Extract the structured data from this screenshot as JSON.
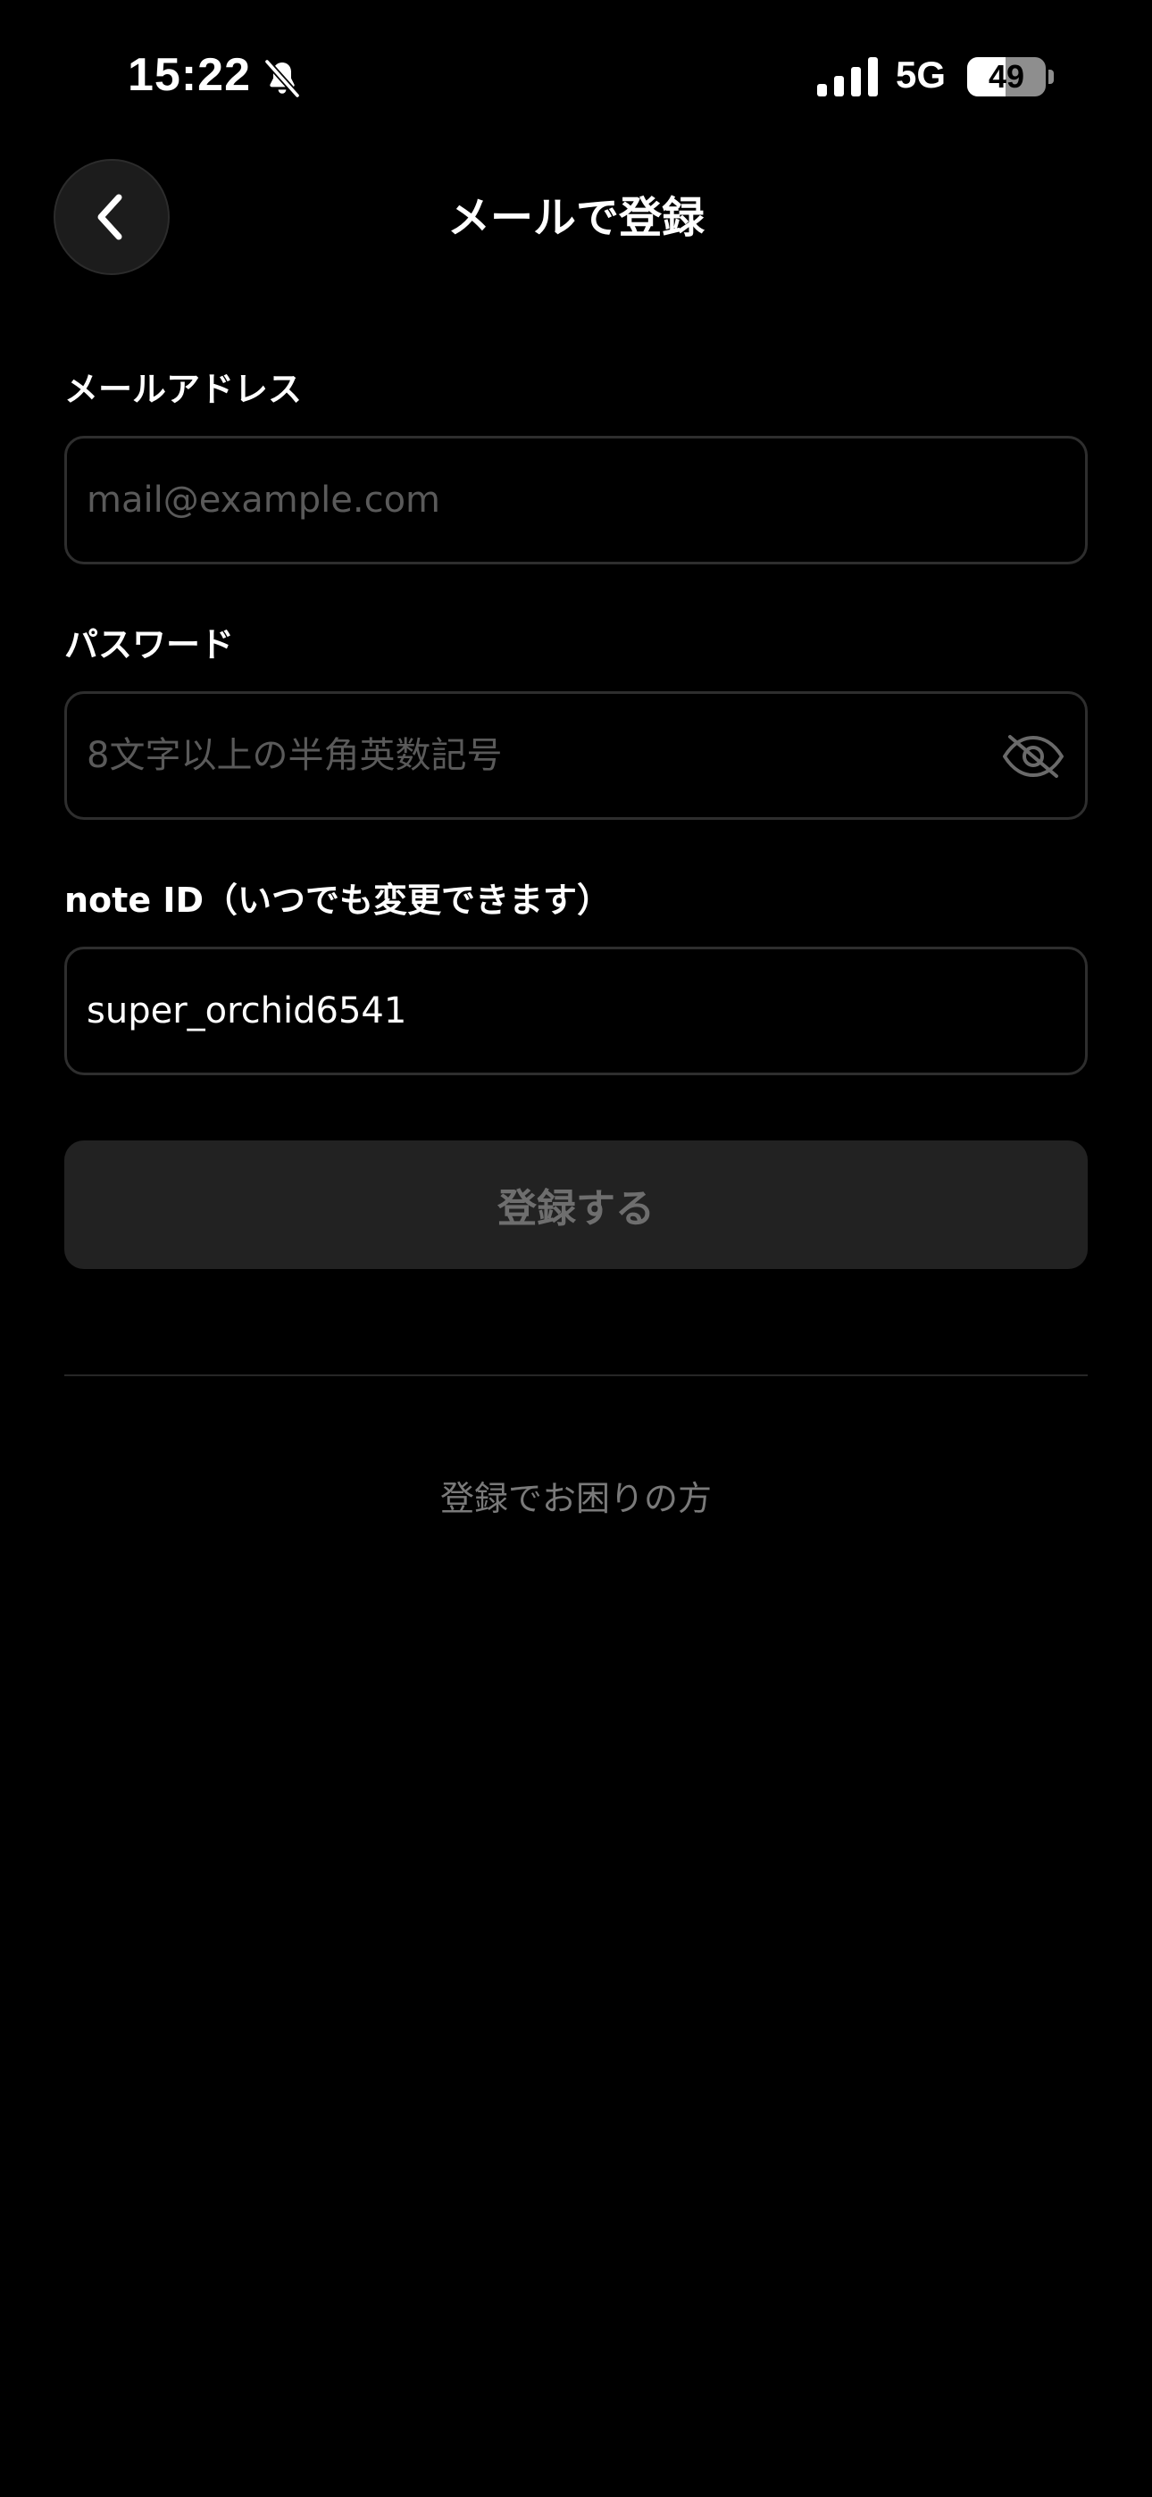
{
  "status_bar": {
    "time": "15:22",
    "network": "5G",
    "battery_percent": 49,
    "battery_text": "49"
  },
  "header": {
    "title": "メールで登録"
  },
  "form": {
    "email": {
      "label": "メールアドレス",
      "placeholder": "mail@example.com",
      "value": ""
    },
    "password": {
      "label": "パスワード",
      "placeholder": "8文字以上の半角英数記号",
      "value": ""
    },
    "note_id": {
      "label": "note ID（いつでも変更できます）",
      "value": "super_orchid6541"
    },
    "submit_label": "登録する"
  },
  "help": {
    "label": "登録でお困りの方"
  },
  "colors": {
    "background": "#000000",
    "field_border": "#2e2e2e",
    "button_disabled_bg": "#222222",
    "button_disabled_text": "#6e6e6e",
    "muted_text": "#7a7a7a"
  },
  "icons": [
    "bell-slash-icon",
    "signal-icon",
    "battery-icon",
    "chevron-left-icon",
    "eye-off-icon"
  ]
}
